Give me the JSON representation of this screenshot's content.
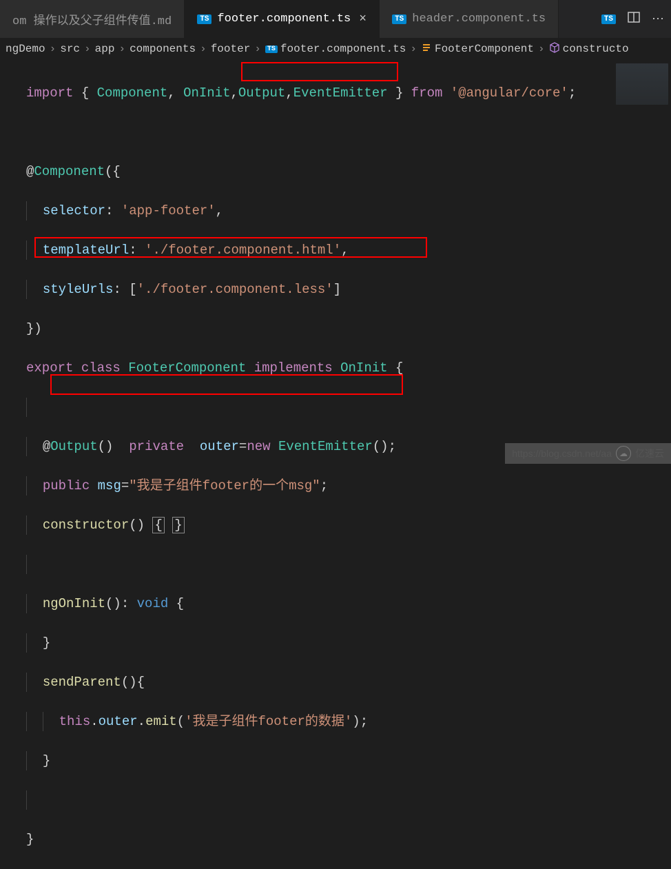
{
  "tabs": [
    {
      "label": "om 操作以及父子组件传值.md",
      "type": "md",
      "active": false
    },
    {
      "label": "footer.component.ts",
      "type": "ts",
      "active": true
    },
    {
      "label": "header.component.ts",
      "type": "ts",
      "active": false
    }
  ],
  "tab_actions": {
    "ts_badge": "TS"
  },
  "breadcrumb": {
    "items": [
      "ngDemo",
      "src",
      "app",
      "components",
      "footer"
    ],
    "file": "footer.component.ts",
    "class": "FooterComponent",
    "member": "constructo"
  },
  "code": {
    "l1": {
      "import": "import",
      "lb": "{",
      "Component": "Component",
      "OnInit": "OnInit",
      "Output": "Output",
      "EventEmitter": "EventEmitter",
      "rb": "}",
      "from": "from",
      "pkg": "'@angular/core'",
      "semi": ";"
    },
    "l3": {
      "at": "@",
      "Component": "Component",
      "open": "({"
    },
    "l4": {
      "selector": "selector",
      "colon": ":",
      "val": "'app-footer'",
      "comma": ","
    },
    "l5": {
      "templateUrl": "templateUrl",
      "colon": ":",
      "val": "'./footer.component.html'",
      "comma": ","
    },
    "l6": {
      "styleUrls": "styleUrls",
      "colon": ":",
      "open": "[",
      "val": "'./footer.component.less'",
      "close": "]"
    },
    "l7": {
      "close": "})"
    },
    "l8": {
      "export": "export",
      "class": "class",
      "name": "FooterComponent",
      "implements": "implements",
      "iface": "OnInit",
      "lb": "{"
    },
    "l10": {
      "at": "@",
      "Output": "Output",
      "paren": "()",
      "private": "private",
      "outer": "outer",
      "eq": "=",
      "new": "new",
      "EventEmitter": "EventEmitter",
      "paren2": "();"
    },
    "l11": {
      "public": "public",
      "msg": "msg",
      "eq": "=",
      "val": "\"我是子组件footer的一个msg\"",
      "semi": ";"
    },
    "l12": {
      "constructor": "constructor",
      "paren": "()",
      "lb": "{",
      "rb": "}"
    },
    "l14": {
      "ngOnInit": "ngOnInit",
      "paren": "()",
      "colon": ":",
      "void": "void",
      "lb": "{"
    },
    "l15": {
      "rb": "}"
    },
    "l16": {
      "sendParent": "sendParent",
      "paren": "()",
      "lb": "{"
    },
    "l17": {
      "this": "this",
      "dot1": ".",
      "outer": "outer",
      "dot2": ".",
      "emit": "emit",
      "open": "(",
      "str": "'我是子组件footer的数据'",
      "close": ");"
    },
    "l18": {
      "rb": "}"
    },
    "l20": {
      "rb": "}"
    }
  },
  "watermark": {
    "url": "https://blog.csdn.net/aa",
    "brand": "亿速云"
  }
}
